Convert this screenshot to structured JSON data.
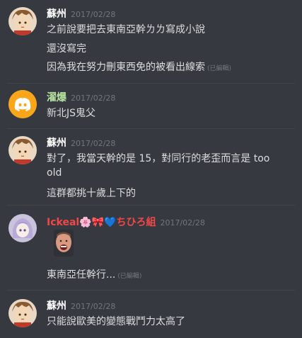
{
  "colors": {
    "background": "#36393f",
    "text": "#dcddde",
    "timestamp": "#72767d",
    "username_default": "#ffffff",
    "username_green": "#b6e3a0",
    "username_red": "#f04747",
    "discord_blurple": "#7289da"
  },
  "messages": [
    {
      "username": "蘇州",
      "timestamp": "2017/02/28",
      "lines": [
        {
          "text": "之前說要把去東南亞幹ㄌㄌ寫成小說",
          "edited": ""
        },
        {
          "text": "還沒寫完",
          "edited": ""
        },
        {
          "text": "因為我在努力刪東西免的被看出線索",
          "edited": "(已編輯)"
        }
      ]
    },
    {
      "username": "濯爆",
      "timestamp": "2017/02/28",
      "lines": [
        {
          "text": "新北JS鬼父",
          "edited": ""
        }
      ]
    },
    {
      "username": "蘇州",
      "timestamp": "2017/02/28",
      "lines": [
        {
          "text": "對了，我當天幹的是 15，對同行的老歪而言是 too",
          "edited": ""
        },
        {
          "text": "old",
          "edited": ""
        },
        {
          "text": "這群都挑十歲上下的",
          "edited": ""
        }
      ]
    },
    {
      "username": "Ickeal🌸🎀💙ちひろ組",
      "timestamp": "2017/02/28",
      "lines": [
        {
          "text": "東南亞任幹行...",
          "edited": "(已編輯)"
        }
      ]
    },
    {
      "username": "蘇州",
      "timestamp": "2017/02/28",
      "lines": [
        {
          "text": "只能說歐美的變態戰鬥力太高了",
          "edited": ""
        }
      ]
    }
  ]
}
